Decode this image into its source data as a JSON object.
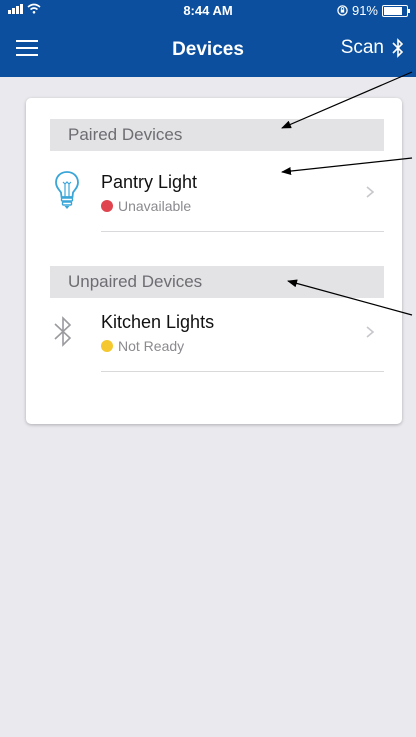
{
  "status_bar": {
    "time": "8:44 AM",
    "battery_text": "91%",
    "battery_level": 0.91,
    "icons": [
      "signal-bars-icon",
      "wifi-icon",
      "orientation-lock-icon",
      "battery-icon"
    ]
  },
  "nav": {
    "title": "Devices",
    "scan_label": "Scan",
    "icons": [
      "menu-icon",
      "bluetooth-icon"
    ]
  },
  "sections": [
    {
      "header": "Paired Devices",
      "devices": [
        {
          "name": "Pantry Light",
          "status": "Unavailable",
          "status_color": "#e0454f",
          "icon": "lightbulb-icon"
        }
      ]
    },
    {
      "header": "Unpaired Devices",
      "devices": [
        {
          "name": "Kitchen Lights",
          "status": "Not Ready",
          "status_color": "#f5c830",
          "icon": "bluetooth-icon"
        }
      ]
    }
  ],
  "colors": {
    "header_blue": "#0b4f9e",
    "bulb_blue": "#3aa6d8"
  }
}
